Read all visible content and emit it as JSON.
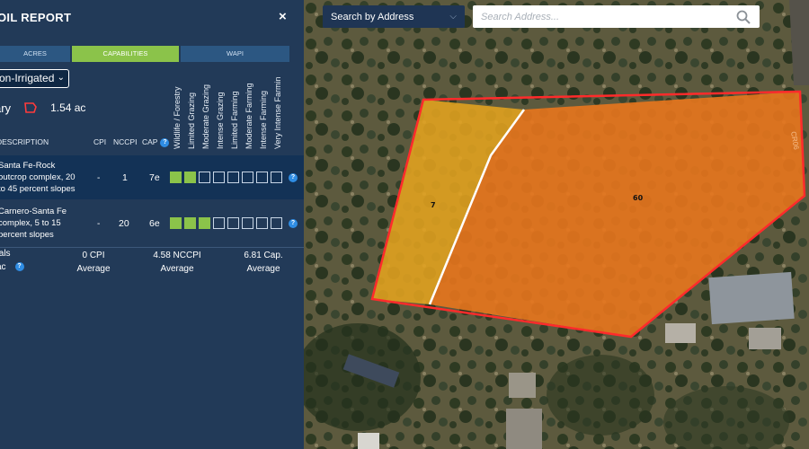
{
  "panel": {
    "title": "OIL REPORT",
    "close_label": "×",
    "tabs": [
      "ACRES",
      "CAPABILITIES",
      "WAPI"
    ],
    "irrigation_select": "on-Irrigated",
    "boundary_label": "ary",
    "boundary_area": "1.54 ac",
    "capability_headers": [
      "Wildlife / Forestry",
      "Limited Grazing",
      "Moderate Grazing",
      "Intense Grazing",
      "Limited Farming",
      "Moderate Farming",
      "Intense Farming",
      "Very Intense Farmin"
    ],
    "columns": {
      "description": "DESCRIPTION",
      "cpi": "CPI",
      "nccpi": "NCCPI",
      "cap": "CAP"
    },
    "rows": [
      {
        "desc_lines": [
          "Santa Fe-Rock",
          "outcrop complex, 20",
          "to 45 percent slopes"
        ],
        "cpi": "-",
        "nccpi": "1",
        "cap": "7e",
        "active_boxes": 2
      },
      {
        "desc_lines": [
          "Carnero-Santa Fe",
          "complex, 5 to 15",
          "percent slopes"
        ],
        "cpi": "-",
        "nccpi": "20",
        "cap": "6e",
        "active_boxes": 3
      }
    ],
    "totals": {
      "label_1": "tals",
      "label_2": "ac",
      "cpi_value": "0 CPI",
      "cpi_sub": "Average",
      "nccpi_value": "4.58 NCCPI",
      "nccpi_sub": "Average",
      "cap_value": "6.81 Cap.",
      "cap_sub": "Average"
    }
  },
  "search": {
    "mode_select": "Search by Address",
    "placeholder": "Search Address..."
  },
  "map": {
    "parcel_labels": [
      "7",
      "60"
    ],
    "road_label": "CR06"
  },
  "colors": {
    "panel_bg": "#223a58",
    "active_tab": "#8bc34a",
    "boundary": "#ff2b2b",
    "parcel_orange": "#e8761d",
    "parcel_yellow": "#e4a31f"
  }
}
